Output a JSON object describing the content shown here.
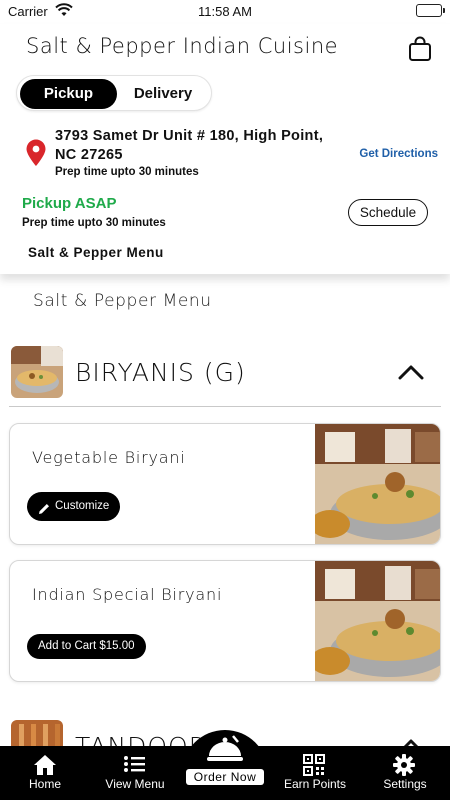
{
  "status_bar": {
    "carrier": "Carrier",
    "time": "11:58 AM"
  },
  "header": {
    "title": "Salt & Pepper Indian Cuisine",
    "mode_options": [
      "Pickup",
      "Delivery"
    ],
    "selected_mode": "Pickup",
    "address": "3793 Samet Dr Unit # 180, High Point, NC 27265",
    "address_prep": "Prep time upto 30 minutes",
    "get_directions": "Get Directions",
    "pickup_label": "Pickup ASAP",
    "pickup_prep": "Prep time upto 30 minutes",
    "schedule_label": "Schedule",
    "menu_name": "Salt & Pepper Menu"
  },
  "main": {
    "section_title": "Salt & Pepper Menu",
    "categories": [
      {
        "title": "BIRYANIS (G)",
        "items": [
          {
            "name": "Vegetable Biryani",
            "action": "Customize"
          },
          {
            "name": "Indian Special Biryani",
            "action": "Add to Cart $15.00"
          }
        ]
      },
      {
        "title": "TANDOOR"
      }
    ]
  },
  "tab_bar": {
    "tabs": [
      "Home",
      "View Menu",
      "Order Now",
      "Earn Points",
      "Settings"
    ],
    "active": "Order Now"
  },
  "colors": {
    "accent_green": "#1faa4a",
    "link_blue": "#1f5fa8",
    "pin_red": "#d9262b",
    "bar": "#000000"
  }
}
